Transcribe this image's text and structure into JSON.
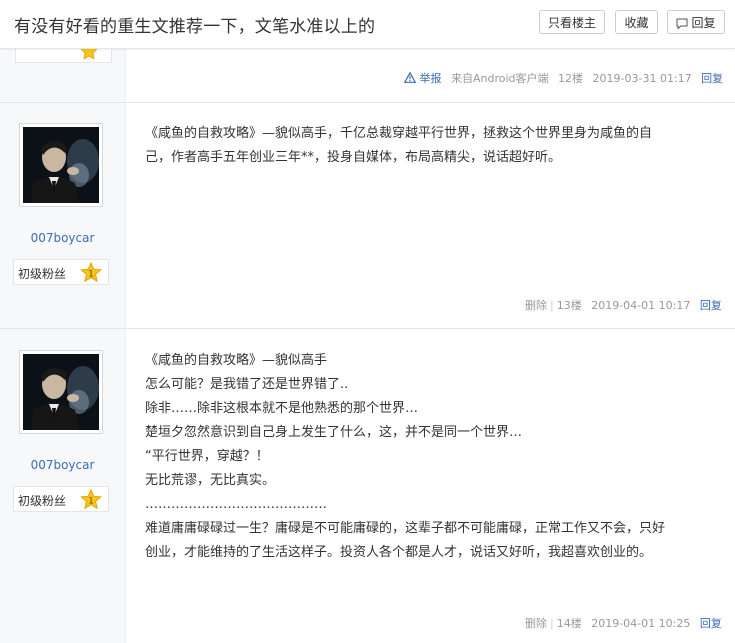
{
  "header": {
    "title": "有没有好看的重生文推荐一下，文笔水准以上的",
    "only_op_label": "只看楼主",
    "favorite_label": "收藏",
    "reply_label": "回复"
  },
  "post12": {
    "report_label": "举报",
    "source": "来自Android客户端",
    "floor": "12楼",
    "time": "2019-03-31 01:17",
    "reply_label": "回复"
  },
  "post13": {
    "username": "007boycar",
    "rank": "初级粉丝",
    "level": "1",
    "lines": [
      "《咸鱼的自救攻略》—貌似高手，千亿总裁穿越平行世界，拯救这个世界里身为咸鱼的自",
      "己，作者高手五年创业三年**，投身自媒体，布局高精尖，说话超好听。"
    ],
    "delete_label": "删除",
    "floor": "13楼",
    "time": "2019-04-01 10:17",
    "reply_label": "回复"
  },
  "post14": {
    "username": "007boycar",
    "rank": "初级粉丝",
    "level": "1",
    "lines": [
      "《咸鱼的自救攻略》—貌似高手",
      "怎么可能？是我错了还是世界错了..",
      "除非……除非这根本就不是他熟悉的那个世界…",
      "楚垣夕忽然意识到自己身上发生了什么，这，并不是同一个世界…",
      "“平行世界，穿越？！",
      "无比荒谬，无比真实。",
      "……………………………………",
      "难道庸庸碌碌过一生？庸碌是不可能庸碌的，这辈子都不可能庸碌，正常工作又不会，只好",
      "创业，才能维持的了生活这样子。投资人各个都是人才，说话又好听，我超喜欢创业的。"
    ],
    "delete_label": "删除",
    "floor": "14楼",
    "time": "2019-04-01 10:25",
    "reply_label": "回复"
  },
  "colors": {
    "link": "#3d6bb5",
    "meta": "#999999",
    "star": "#f5b400"
  }
}
